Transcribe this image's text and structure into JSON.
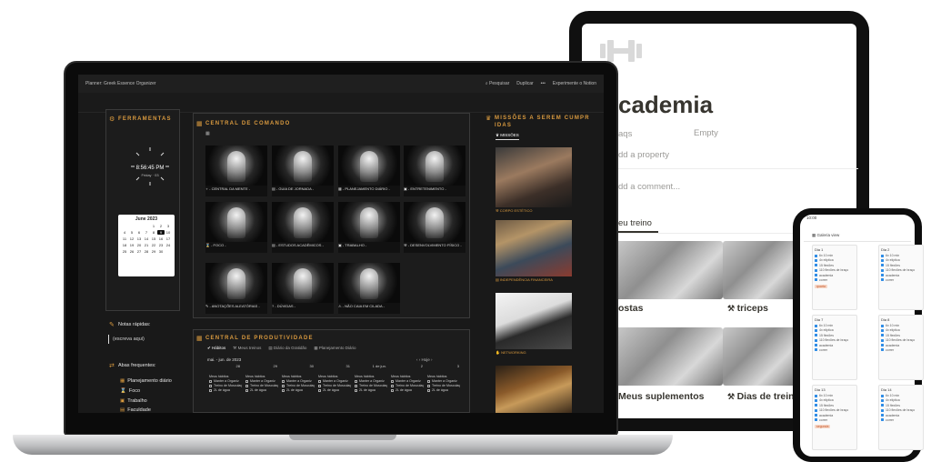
{
  "laptop": {
    "topbar": {
      "breadcrumb": "Planner: Greek Essence Organizer",
      "search": "Pesquisar",
      "duplicate": "Duplicar",
      "more": "•••",
      "try_notion": "Experimente o Notion"
    },
    "tools": {
      "title": "FERRAMENTAS",
      "clock_time": "8:56:45 PM",
      "clock_date": "Friday · 03",
      "calendar": {
        "month": "June 2023",
        "days": [
          "",
          "",
          "",
          "",
          "1",
          "2",
          "3",
          "4",
          "5",
          "6",
          "7",
          "8",
          "9",
          "10",
          "11",
          "12",
          "13",
          "14",
          "15",
          "16",
          "17",
          "18",
          "19",
          "20",
          "21",
          "22",
          "23",
          "24",
          "25",
          "26",
          "27",
          "28",
          "29",
          "30",
          ""
        ],
        "selected": "9"
      }
    },
    "notes": {
      "title": "Notas rápidas:",
      "placeholder": "(escreva aqui)"
    },
    "frequent": {
      "title": "Abas frequentes:",
      "items": [
        "Planejamento diário",
        "Foco",
        "Trabalho",
        "Faculdade"
      ]
    },
    "command": {
      "title": "CENTRAL DE COMANDO",
      "cards": [
        "- CENTRAL DA MENTE -",
        "- GUIA DE JORNADA -",
        "- PLANEJAMENTO DIÁRIO -",
        "- ENTRETENIMENTO -",
        "- FOCO -",
        "- ESTUDOS ACADÊMICOS -",
        "- TRABALHO -",
        "- DESENVOLVIMENTO FÍSICO -",
        "- ANOTAÇÕES ALEATÓRIAS -",
        "- DÚVIDAS -",
        "- NÃO CAIA EM CILADA -"
      ]
    },
    "productivity": {
      "title": "CENTRAL DE PRODUTIVIDADE",
      "tabs": [
        "Hábitos",
        "Meus treinos",
        "Diário da Gratidão",
        "Planejamento Diário"
      ],
      "range": "mai. - jun. de 2023",
      "today": "Hoje",
      "days": [
        "28",
        "29",
        "30",
        "31",
        "1 de jun.",
        "2",
        "3"
      ],
      "habit_title": "Meus hábitos",
      "habits": [
        "Manter a Organiz",
        "Treino de Musculaç",
        "2L de água"
      ]
    },
    "missions": {
      "title_line1": "MISSÕES A SEREM CUMPR",
      "title_line2": "IDAS",
      "tab": "MISSÕES",
      "items": [
        "CORPO ESTÉTICO",
        "INDEPENDÊNCIA FINANCEIRA",
        "NETWORKING",
        ""
      ]
    }
  },
  "tablet": {
    "title": "cademia",
    "prop1": "aqs",
    "prop1_value": "Empty",
    "add_property": "dd a property",
    "add_comment": "dd a comment...",
    "view_tab": "eu treino",
    "captions": [
      "ostas",
      "triceps",
      "Meus suplementos",
      "Dias de treino"
    ]
  },
  "phone": {
    "status_time": "10:00",
    "view_name": "Galeria view",
    "cards": [
      {
        "title": "Dia 1",
        "tag": "quarta"
      },
      {
        "title": "Dia 2",
        "tag": ""
      },
      {
        "title": "Dia 7",
        "tag": ""
      },
      {
        "title": "Dia 8",
        "tag": ""
      },
      {
        "title": "Dia 13",
        "tag": "segunda"
      },
      {
        "title": "Dia 14",
        "tag": ""
      }
    ],
    "rows": [
      "6x 10 min",
      "4x elíptica",
      "15 flexões",
      "110 flexões de braço",
      "academia",
      "correr"
    ]
  }
}
